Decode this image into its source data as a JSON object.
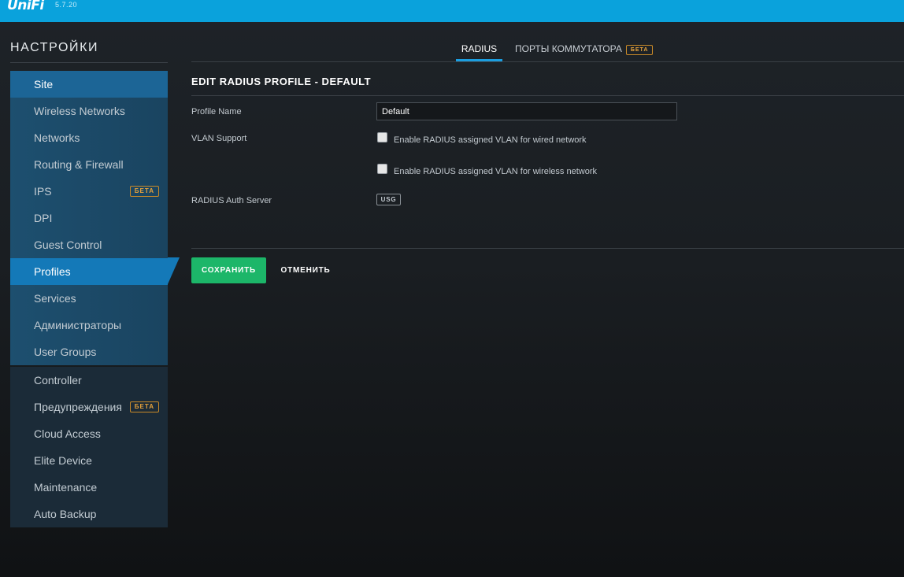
{
  "topbar": {
    "logo": "UniFi",
    "version": "5.7.20",
    "color": "#0aa2dc"
  },
  "sidebar": {
    "title": "НАСТРОЙКИ",
    "groups": [
      {
        "items": [
          {
            "label": "Site"
          },
          {
            "label": "Wireless Networks"
          },
          {
            "label": "Networks"
          },
          {
            "label": "Routing & Firewall"
          },
          {
            "label": "IPS",
            "badge": "БЕТА"
          },
          {
            "label": "DPI"
          },
          {
            "label": "Guest Control"
          },
          {
            "label": "Profiles",
            "active": true
          },
          {
            "label": "Services"
          },
          {
            "label": "Администраторы"
          },
          {
            "label": "User Groups"
          }
        ]
      },
      {
        "items": [
          {
            "label": "Controller"
          },
          {
            "label": "Предупреждения",
            "badge": "БЕТА"
          },
          {
            "label": "Cloud Access"
          },
          {
            "label": "Elite Device"
          },
          {
            "label": "Maintenance"
          },
          {
            "label": "Auto Backup"
          }
        ]
      }
    ]
  },
  "tabs": {
    "radius": "RADIUS",
    "ports": "ПОРТЫ КОММУТАТОРА",
    "ports_badge": "БЕТА",
    "active": "radius"
  },
  "form": {
    "title": "EDIT RADIUS PROFILE - DEFAULT",
    "profile_name_label": "Profile Name",
    "profile_name_value": "Default",
    "vlan_label": "VLAN Support",
    "vlan_wired": {
      "label": "Enable RADIUS assigned VLAN for wired network",
      "checked": false
    },
    "vlan_wireless": {
      "label": "Enable RADIUS assigned VLAN for wireless network",
      "checked": false
    },
    "auth_server_label": "RADIUS Auth Server",
    "auth_server_badge": "USG",
    "save_label": "СОХРАНИТЬ",
    "cancel_label": "ОТМЕНИТЬ"
  },
  "colors": {
    "accent": "#1479b8",
    "save": "#1cb669",
    "beta": "#e6a23c"
  }
}
